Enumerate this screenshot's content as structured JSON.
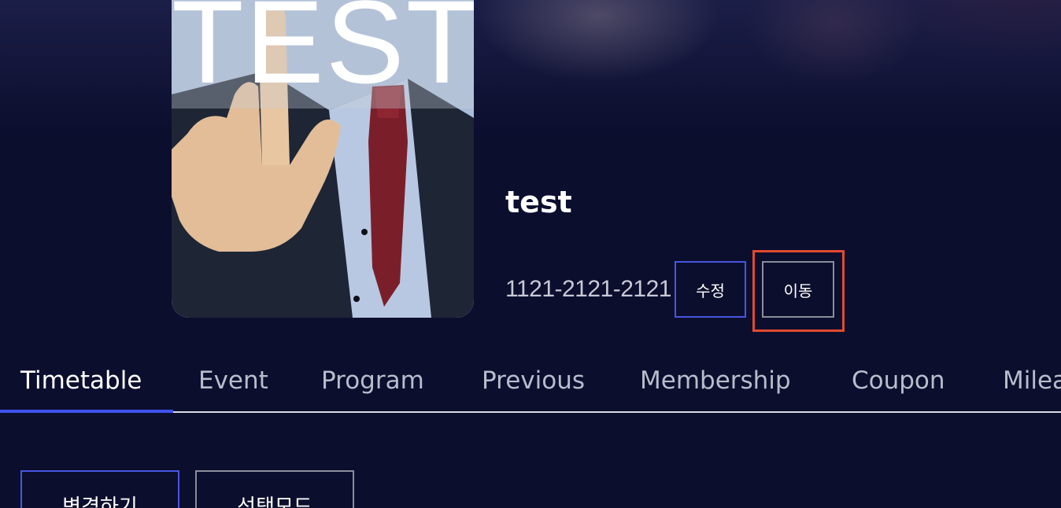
{
  "thumbnail": {
    "overlay_text": "TEST"
  },
  "profile": {
    "name": "test",
    "phone": "1121-2121-2121",
    "edit_label": "수정",
    "move_label": "이동"
  },
  "tabs": [
    {
      "label": "Timetable",
      "active": true
    },
    {
      "label": "Event",
      "active": false
    },
    {
      "label": "Program",
      "active": false
    },
    {
      "label": "Previous",
      "active": false
    },
    {
      "label": "Membership",
      "active": false
    },
    {
      "label": "Coupon",
      "active": false
    },
    {
      "label": "Mileage",
      "active": false
    }
  ],
  "actions": {
    "change_label": "변경하기",
    "select_mode_label": "선택모드"
  },
  "colors": {
    "background": "#0c0e2e",
    "accent": "#3f53ee",
    "highlight": "#e24a30"
  }
}
